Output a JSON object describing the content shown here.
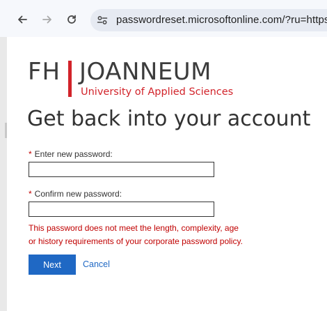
{
  "browser": {
    "url": "passwordreset.microsoftonline.com/?ru=https"
  },
  "logo": {
    "fh": "FH",
    "name": "JOANNEUM",
    "subtitle": "University of Applied Sciences"
  },
  "form": {
    "title": "Get back into your account",
    "new_password": {
      "required_mark": "*",
      "label": "Enter new password:",
      "value": ""
    },
    "confirm_password": {
      "required_mark": "*",
      "label": "Confirm new password:",
      "value": ""
    },
    "error_line1": "This password does not meet the length, complexity, age",
    "error_line2": "or history requirements of your corporate password policy.",
    "next_label": "Next",
    "cancel_label": "Cancel"
  },
  "colors": {
    "brand_red": "#d2232a",
    "error": "#c00000",
    "primary_button": "#1f68c4",
    "link": "#1f68c4"
  }
}
